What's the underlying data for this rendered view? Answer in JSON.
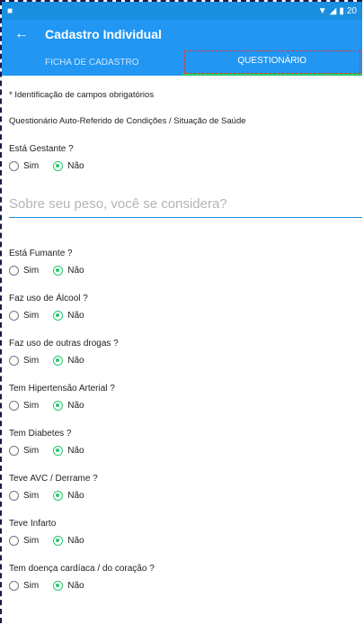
{
  "statusbar": {
    "time": "20"
  },
  "appbar": {
    "title": "Cadastro Individual"
  },
  "tabs": [
    {
      "label": "FICHA DE CADASTRO",
      "active": false
    },
    {
      "label": "QUESTIONÁRIO",
      "active": true
    }
  ],
  "note": "* Identificação de campos obrigatórios",
  "subtitle": "Questionário Auto-Referido de Condições / Situação de Saúde",
  "options": {
    "yes": "Sim",
    "no": "Não"
  },
  "weight_field": {
    "placeholder": "Sobre seu peso, você se considera?"
  },
  "questions": [
    {
      "label": "Está Gestante ?",
      "answer": "Não"
    },
    {
      "label": "Está Fumante ?",
      "answer": "Não"
    },
    {
      "label": "Faz uso de Álcool ?",
      "answer": "Não"
    },
    {
      "label": "Faz uso de outras drogas ?",
      "answer": "Não"
    },
    {
      "label": "Tem Hipertensão Arterial ?",
      "answer": "Não"
    },
    {
      "label": "Tem Diabetes ?",
      "answer": "Não"
    },
    {
      "label": "Teve AVC / Derrame ?",
      "answer": "Não"
    },
    {
      "label": "Teve Infarto",
      "answer": "Não"
    },
    {
      "label": "Tem doença cardíaca / do coração ?",
      "answer": "Não"
    }
  ],
  "colors": {
    "primary": "#2196f3",
    "statusbar": "#1a8fe0",
    "accent": "#28c76f"
  }
}
